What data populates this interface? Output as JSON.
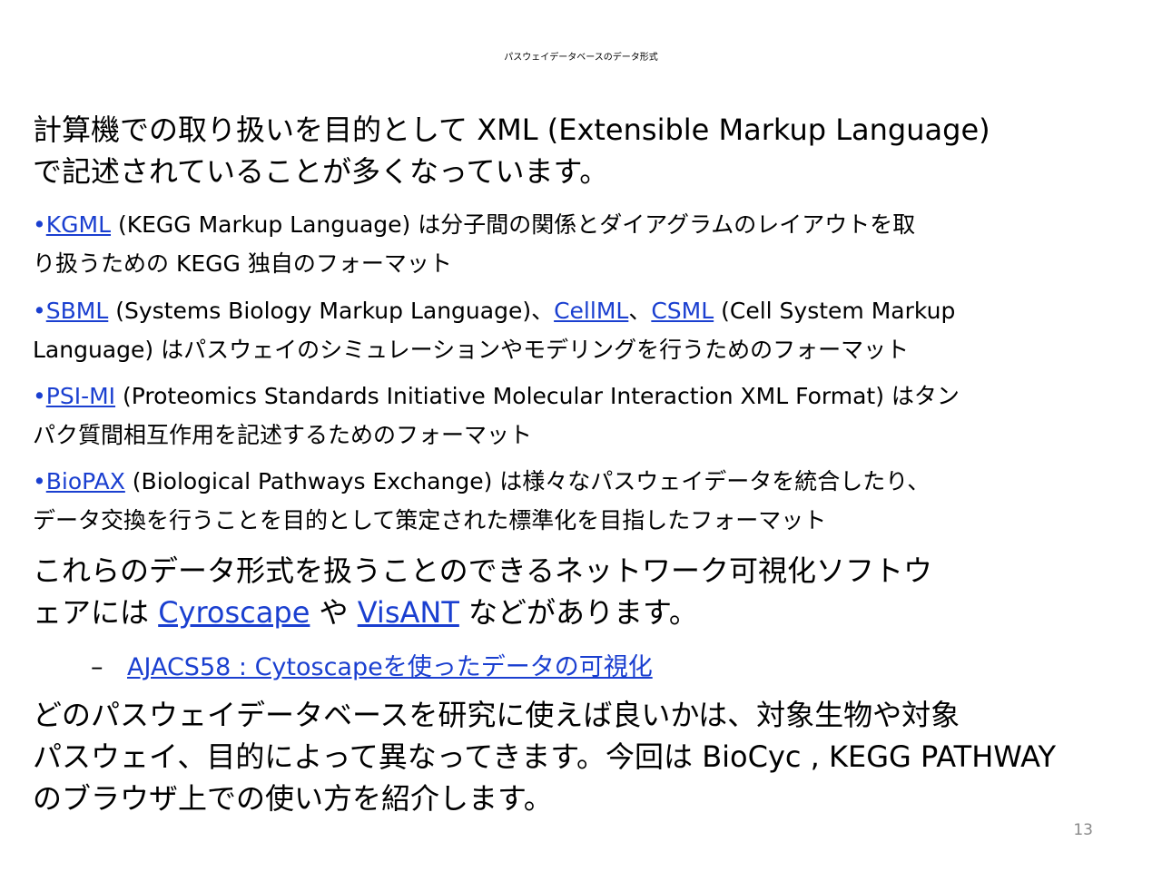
{
  "title": "パスウェイデータベースのデータ形式",
  "intro": {
    "line1": "計算機での取り扱いを目的として XML (Extensible Markup Language)",
    "line2": " で記述されていることが多くなっています。"
  },
  "bullets": [
    {
      "link": "KGML",
      "text1": " (KEGG Markup Language) は分子間の関係とダイアグラムのレイアウトを取",
      "line2": "り扱うための KEGG 独自のフォーマット"
    },
    {
      "link": "SBML",
      "text1": " (Systems Biology Markup Language)、",
      "link2": "CellML",
      "sep": "、",
      "link3": "CSML",
      "text2": " (Cell System Markup",
      "line2": "Language) はパスウェイのシミュレーションやモデリングを行うためのフォーマット"
    },
    {
      "link": "PSI-MI",
      "text1": " (Proteomics Standards Initiative Molecular Interaction XML Format) はタン",
      "line2": "パク質間相互作用を記述するためのフォーマット"
    },
    {
      "link": "BioPAX",
      "text1": " (Biological Pathways Exchange) は様々なパスウェイデータを統合したり、",
      "line2": "データ交換を行うことを目的として策定された標準化を目指したフォーマット"
    }
  ],
  "software": {
    "line1": "これらのデータ形式を扱うことのできるネットワーク可視化ソフトウ",
    "pre": "ェアには ",
    "link1": "Cyroscape",
    "mid": " や ",
    "link2": "VisANT",
    "post": " などがあります。"
  },
  "sublink": {
    "dash": "–",
    "text": "AJACS58 : Cytoscapeを使ったデータの可視化"
  },
  "closing": {
    "line1": "どのパスウェイデータベースを研究に使えば良いかは、対象生物や対象",
    "line2": "パスウェイ、目的によって異なってきます。今回は BioCyc , KEGG PATHWAY",
    "line3": " のブラウザ上での使い方を紹介します。"
  },
  "page_number": "13",
  "colors": {
    "link": "#1a3fd0",
    "text": "#000000",
    "page_number": "#888888"
  }
}
